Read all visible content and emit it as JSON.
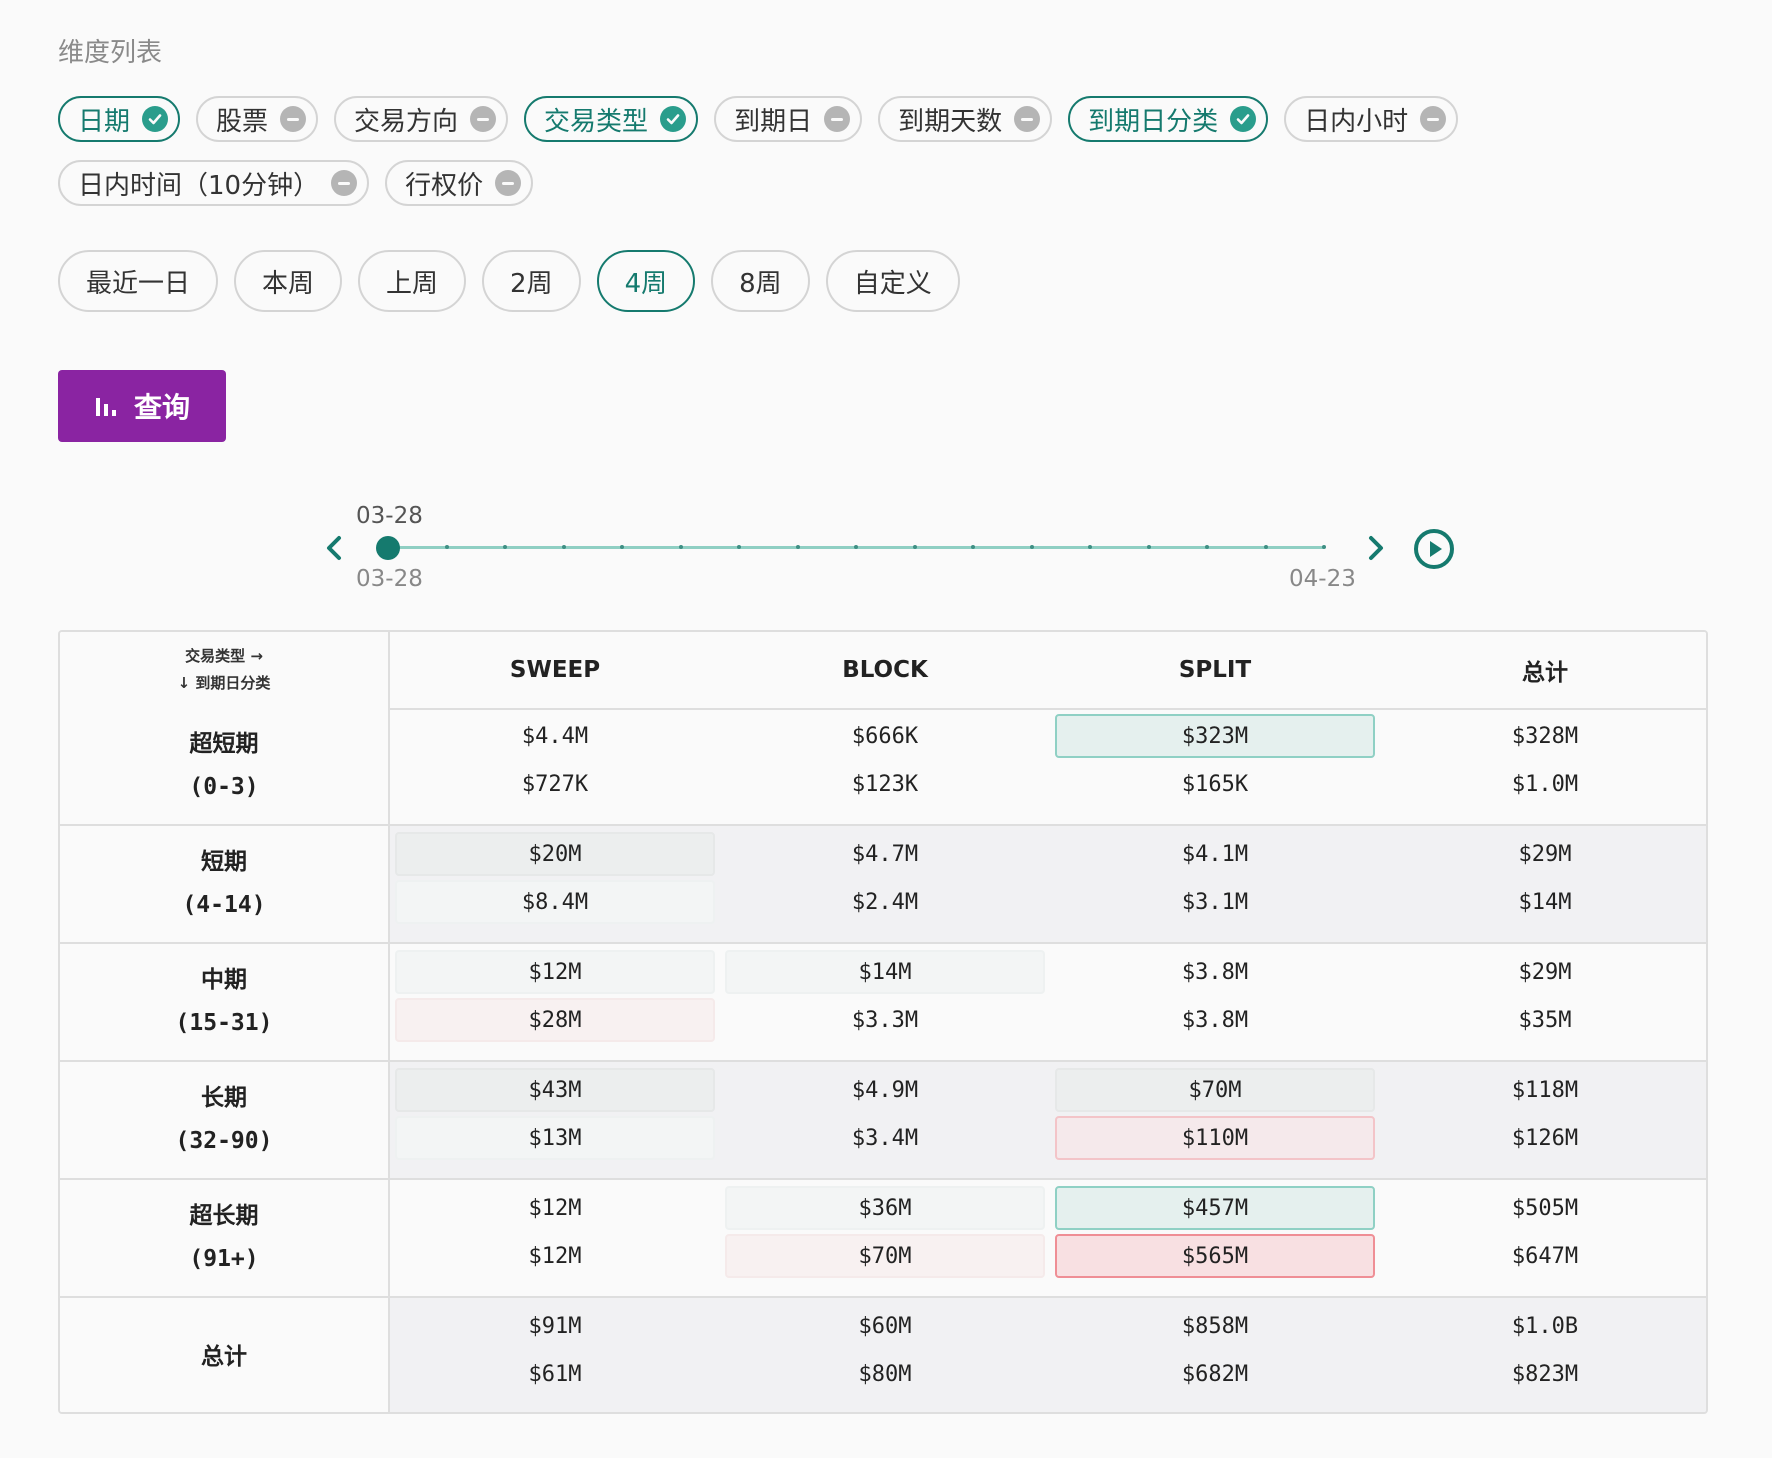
{
  "dimensions": {
    "title": "维度列表",
    "chips": [
      {
        "label": "日期",
        "selected": true
      },
      {
        "label": "股票",
        "selected": false
      },
      {
        "label": "交易方向",
        "selected": false
      },
      {
        "label": "交易类型",
        "selected": true
      },
      {
        "label": "到期日",
        "selected": false
      },
      {
        "label": "到期天数",
        "selected": false
      },
      {
        "label": "到期日分类",
        "selected": true
      },
      {
        "label": "日内小时",
        "selected": false
      },
      {
        "label": "日内时间（10分钟）",
        "selected": false
      },
      {
        "label": "行权价",
        "selected": false
      }
    ]
  },
  "ranges": {
    "items": [
      "最近一日",
      "本周",
      "上周",
      "2周",
      "4周",
      "8周",
      "自定义"
    ],
    "active": "4周"
  },
  "query_button": {
    "label": "查询",
    "icon": "bar-chart-icon"
  },
  "timeline": {
    "current": "03-28",
    "start": "03-28",
    "end": "04-23",
    "ticks": 17,
    "position": 0,
    "icons": {
      "prev": "chevron-left-icon",
      "next": "chevron-right-icon",
      "play": "play-circle-icon"
    }
  },
  "table": {
    "corner_col": "交易类型 →",
    "corner_row": "↓ 到期日分类",
    "columns": [
      "SWEEP",
      "BLOCK",
      "SPLIT",
      "总计"
    ],
    "rows": [
      {
        "name": "超短期",
        "range": "(0-3)",
        "cells": [
          [
            "$4.4M",
            "$727K"
          ],
          [
            "$666K",
            "$123K"
          ],
          [
            "$323M",
            "$165K"
          ],
          [
            "$328M",
            "$1.0M"
          ]
        ]
      },
      {
        "name": "短期",
        "range": "(4-14)",
        "cells": [
          [
            "$20M",
            "$8.4M"
          ],
          [
            "$4.7M",
            "$2.4M"
          ],
          [
            "$4.1M",
            "$3.1M"
          ],
          [
            "$29M",
            "$14M"
          ]
        ]
      },
      {
        "name": "中期",
        "range": "(15-31)",
        "cells": [
          [
            "$12M",
            "$28M"
          ],
          [
            "$14M",
            "$3.3M"
          ],
          [
            "$3.8M",
            "$3.8M"
          ],
          [
            "$29M",
            "$35M"
          ]
        ]
      },
      {
        "name": "长期",
        "range": "(32-90)",
        "cells": [
          [
            "$43M",
            "$13M"
          ],
          [
            "$4.9M",
            "$3.4M"
          ],
          [
            "$70M",
            "$110M"
          ],
          [
            "$118M",
            "$126M"
          ]
        ]
      },
      {
        "name": "超长期",
        "range": "(91+)",
        "cells": [
          [
            "$12M",
            "$12M"
          ],
          [
            "$36M",
            "$70M"
          ],
          [
            "$457M",
            "$565M"
          ],
          [
            "$505M",
            "$647M"
          ]
        ]
      },
      {
        "name": "总计",
        "range": "",
        "cells": [
          [
            "$91M",
            "$61M"
          ],
          [
            "$60M",
            "$80M"
          ],
          [
            "$858M",
            "$682M"
          ],
          [
            "$1.0B",
            "$823M"
          ]
        ]
      }
    ],
    "heat": [
      [
        [
          "",
          ""
        ],
        [
          "",
          ""
        ],
        [
          "g3",
          ""
        ],
        [
          "",
          ""
        ]
      ],
      [
        [
          "g2",
          "g1"
        ],
        [
          "",
          ""
        ],
        [
          "",
          ""
        ],
        [
          "",
          ""
        ]
      ],
      [
        [
          "g1",
          "r1"
        ],
        [
          "g1",
          ""
        ],
        [
          "",
          ""
        ],
        [
          "",
          ""
        ]
      ],
      [
        [
          "g2",
          "g1"
        ],
        [
          "",
          ""
        ],
        [
          "g2",
          "r2"
        ],
        [
          "",
          ""
        ]
      ],
      [
        [
          "",
          ""
        ],
        [
          "g1",
          "r1"
        ],
        [
          "g3",
          "r3"
        ],
        [
          "",
          ""
        ]
      ],
      [
        [
          "",
          ""
        ],
        [
          "",
          ""
        ],
        [
          "",
          ""
        ],
        [
          "",
          ""
        ]
      ]
    ]
  }
}
